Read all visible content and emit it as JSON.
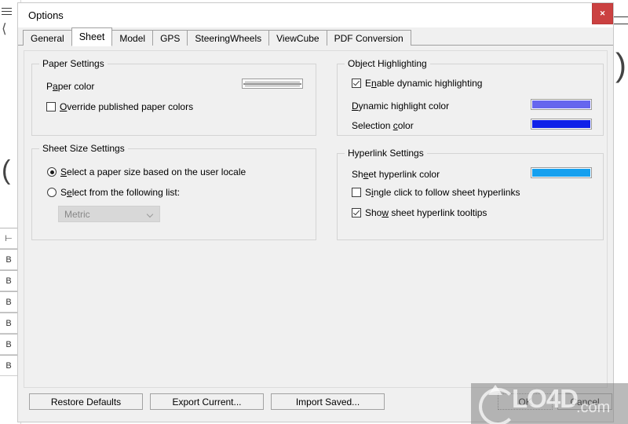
{
  "window": {
    "title": "Options",
    "close_label": "✕"
  },
  "tabs": [
    {
      "label": "General",
      "active": false
    },
    {
      "label": "Sheet",
      "active": true
    },
    {
      "label": "Model",
      "active": false
    },
    {
      "label": "GPS",
      "active": false
    },
    {
      "label": "SteeringWheels",
      "active": false
    },
    {
      "label": "ViewCube",
      "active": false
    },
    {
      "label": "PDF Conversion",
      "active": false
    }
  ],
  "paper_settings": {
    "group_title": "Paper Settings",
    "paper_color_label_pre": "P",
    "paper_color_label_accel": "a",
    "paper_color_label_post": "per color",
    "paper_color_value": "#ffffff",
    "override_pre": "",
    "override_accel": "O",
    "override_post": "verride published paper colors",
    "override_checked": false
  },
  "sheet_size_settings": {
    "group_title": "Sheet Size Settings",
    "locale_pre": "",
    "locale_accel": "S",
    "locale_post": "elect a paper size based on the user locale",
    "locale_selected": true,
    "list_pre": "S",
    "list_accel": "e",
    "list_post": "lect from the following list:",
    "list_selected": false,
    "combo_value": "Metric",
    "combo_enabled": false
  },
  "object_highlighting": {
    "group_title": "Object Highlighting",
    "enable_pre": "E",
    "enable_accel": "n",
    "enable_post": "able dynamic highlighting",
    "enable_checked": true,
    "dynamic_pre": "",
    "dynamic_accel": "D",
    "dynamic_post": "ynamic highlight color",
    "dynamic_color": "#6666ee",
    "selection_pre": "Selection ",
    "selection_accel": "c",
    "selection_post": "olor",
    "selection_color": "#0f20e8"
  },
  "hyperlink_settings": {
    "group_title": "Hyperlink Settings",
    "sheet_link_pre": "Sh",
    "sheet_link_accel": "e",
    "sheet_link_post": "et hyperlink color",
    "sheet_link_color": "#16a0ef",
    "single_click_pre": "S",
    "single_click_accel": "i",
    "single_click_post": "ngle click to follow sheet hyperlinks",
    "single_click_checked": false,
    "tooltips_pre": "Sho",
    "tooltips_accel": "w",
    "tooltips_post": " sheet hyperlink tooltips",
    "tooltips_checked": true
  },
  "buttons": {
    "restore_defaults": "Restore Defaults",
    "export_current": "Export Current...",
    "import_saved": "Import Saved...",
    "ok": "OK",
    "cancel": "Cancel"
  },
  "watermark": {
    "text": "LO4D",
    "suffix": ".com"
  }
}
